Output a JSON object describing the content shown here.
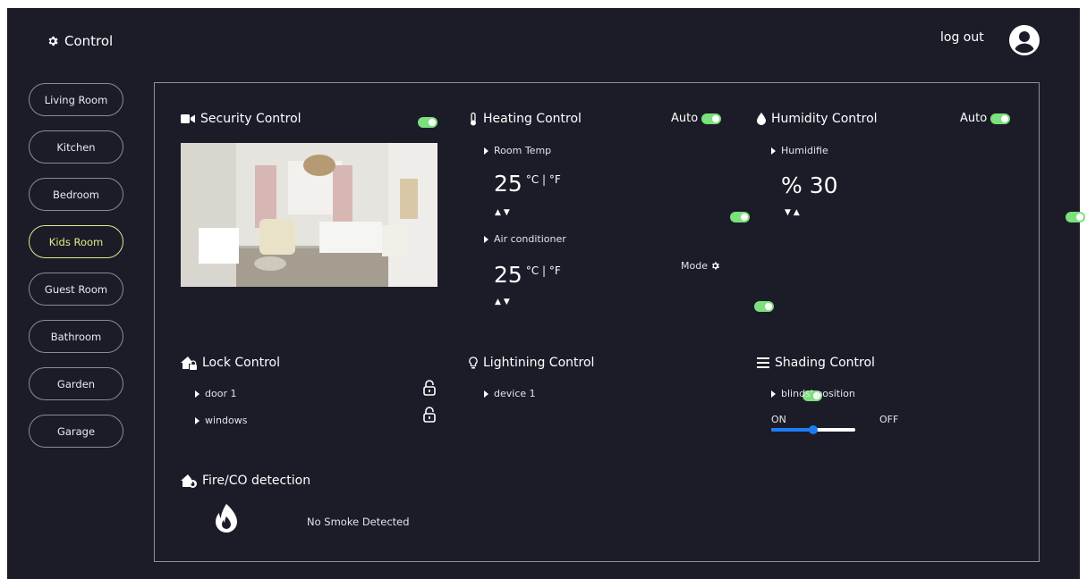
{
  "header": {
    "brand": "Control",
    "logout": "log out"
  },
  "nav": {
    "items": [
      {
        "label": "Living Room"
      },
      {
        "label": "Kitchen"
      },
      {
        "label": "Bedroom"
      },
      {
        "label": "Kids Room"
      },
      {
        "label": "Guest Room"
      },
      {
        "label": "Bathroom"
      },
      {
        "label": "Garden"
      },
      {
        "label": "Garage"
      }
    ],
    "active": "Kids Room"
  },
  "security": {
    "title": "Security Control",
    "enabled": true
  },
  "heating": {
    "title": "Heating Control",
    "mode_label": "Auto",
    "room_temp": {
      "label": "Room Temp",
      "value": "25",
      "unit": "°C | °F",
      "arrows": "▲▼"
    },
    "air_conditioner": {
      "label": "Air conditioner",
      "value": "25",
      "unit": "°C | °F",
      "mode_label": "Mode",
      "arrows": "▲▼"
    }
  },
  "humidity": {
    "title": "Humidity Control",
    "mode_label": "Auto",
    "humidifier": {
      "label": "Humidifie",
      "value": "% 30",
      "arrows": "▼▲"
    }
  },
  "lock": {
    "title": "Lock Control",
    "items": [
      {
        "label": "door 1"
      },
      {
        "label": "windows"
      }
    ]
  },
  "lighting": {
    "title": "Lightining Control",
    "items": [
      {
        "label": "device 1"
      }
    ]
  },
  "shading": {
    "title": "Shading Control",
    "blinds": {
      "label": "blinds' position",
      "on_label": "ON",
      "off_label": "OFF",
      "level": 0.5
    }
  },
  "fire": {
    "title": "Fire/CO detection",
    "status": "No Smoke Detected"
  },
  "colors": {
    "background": "#1b1c27",
    "toggle": "#7be07d",
    "active_nav": "#e2ea8b",
    "slider": "#1e7cf2"
  }
}
